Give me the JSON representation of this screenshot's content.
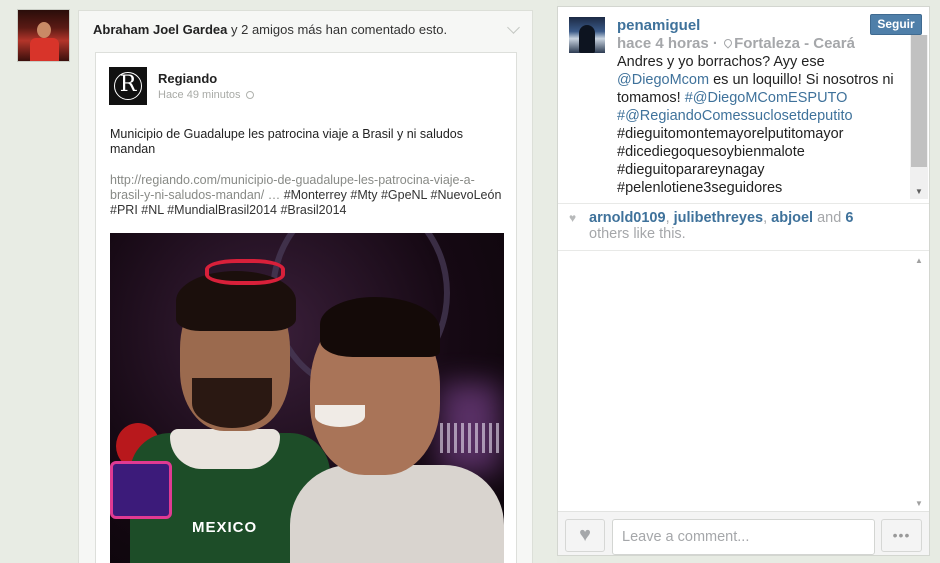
{
  "facebook_story": {
    "header_names": "Abraham Joel Gardea",
    "header_rest": " y 2 amigos más han comentado esto.",
    "page_name": "Regiando",
    "time": "Hace 49 minutos",
    "logo_letter": "R",
    "post_text": "Municipio de Guadalupe les patrocina viaje a Brasil y ni saludos mandan",
    "link_url": "http://regiando.com/municipio-de-guadalupe-les-patrocina-viaje-a-brasil-y-ni-saludos-mandan/",
    "link_ellipsis": " … ",
    "link_tags": "#Monterrey #Mty #GpeNL #NuevoLeón #PRI #NL #MundialBrasil2014 #Brasil2014",
    "photo_shirt_text": "MEXICO"
  },
  "instagram_post": {
    "username": "penamiguel",
    "time": "hace 4 horas",
    "separator": " · ",
    "location": "Fortaleza - Ceará",
    "follow_label": "Seguir",
    "caption": {
      "p1": "Andres y yo borrachos? Ayy ese ",
      "m1": "@DiegoMcom",
      "p2": " es un loquillo! Si nosotros ni tomamos! ",
      "m2": "#@DiegoMComESPUTO",
      "p3": " ",
      "m3": "#@RegiandoComessuclosetdeputito",
      "p4": " #dieguitomontemayorelputitomayor #dicediegoquesoybienmalote #dieguitoparareynagay #pelenlotiene3seguidores"
    },
    "likes": {
      "u1": "arnold0109",
      "sep1": ", ",
      "u2": "julibethreyes",
      "sep2": ", ",
      "u3": "abjoel",
      "and_text": " and ",
      "count": "6",
      "rest": " others like this."
    },
    "comment_placeholder": "Leave a comment...",
    "more_label": "•••"
  },
  "icons": [
    "chevron-down-icon",
    "globe-icon",
    "location-pin-icon",
    "heart-icon",
    "more-icon"
  ],
  "colors": {
    "instagram_blue": "#3f729b",
    "follow_button": "#4f7fa9",
    "muted_text": "#a5a7aa",
    "page_background": "#e7ebe3"
  }
}
